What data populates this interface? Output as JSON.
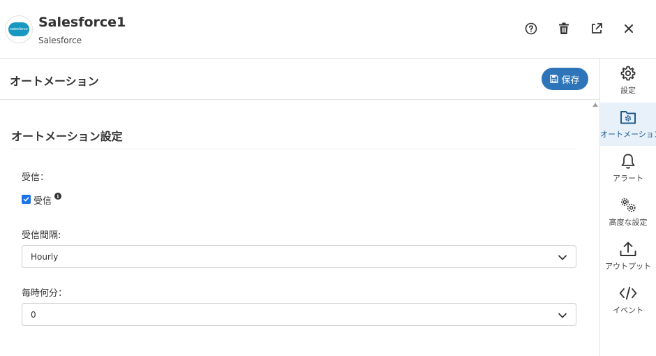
{
  "header": {
    "title": "Salesforce1",
    "subtitle": "Salesforce",
    "logo_text": "salesforce",
    "icons": [
      "help-icon",
      "trash-icon",
      "external-link-icon",
      "close-icon"
    ]
  },
  "main": {
    "title": "オートメーション",
    "save_label": "保存",
    "section_title": "オートメーション設定",
    "receive_label": "受信：",
    "receive_checkbox_label": "受信",
    "receive_checked": true,
    "interval_label": "受信間隔:",
    "interval_value": "Hourly",
    "minute_label": "毎時何分：",
    "minute_value": "0"
  },
  "sidebar": {
    "items": [
      {
        "label": "設定",
        "icon": "gear-icon",
        "active": false
      },
      {
        "label": "オートメーション",
        "icon": "folder-gear-icon",
        "active": true
      },
      {
        "label": "アラート",
        "icon": "bell-icon",
        "active": false
      },
      {
        "label": "高度な設定",
        "icon": "gears-icon",
        "active": false
      },
      {
        "label": "アウトプット",
        "icon": "upload-icon",
        "active": false
      },
      {
        "label": "イベント",
        "icon": "code-icon",
        "active": false
      }
    ]
  },
  "colors": {
    "accent": "#2d74b8",
    "active_bg": "#e8f1fa",
    "checkbox": "#1a73e8",
    "brand_cloud": "#1798c1"
  }
}
